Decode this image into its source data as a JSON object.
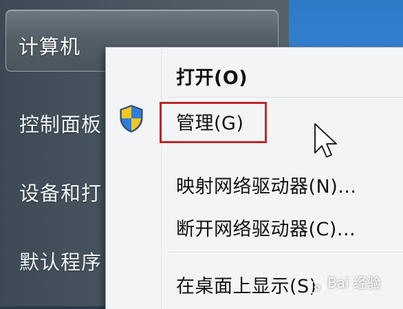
{
  "start_menu": {
    "items": [
      {
        "label": "计算机"
      },
      {
        "label": "控制面板"
      },
      {
        "label": "设备和打"
      },
      {
        "label": "默认程序"
      }
    ]
  },
  "context_menu": {
    "items": [
      {
        "label": "打开(O)",
        "bold": true
      },
      {
        "label": "管理(G)",
        "icon": "uac-shield-icon",
        "highlighted": true
      },
      {
        "label": "映射网络驱动器(N)..."
      },
      {
        "label": "断开网络驱动器(C)..."
      },
      {
        "label": "在桌面上显示(S)"
      }
    ],
    "highlight_color": "#b8292a"
  },
  "watermark": {
    "text": "Bai 经验"
  },
  "colors": {
    "start_pane": "#4e5a64",
    "desktop": "#3a8ad8",
    "menu_bg": "#f3f4f6"
  }
}
